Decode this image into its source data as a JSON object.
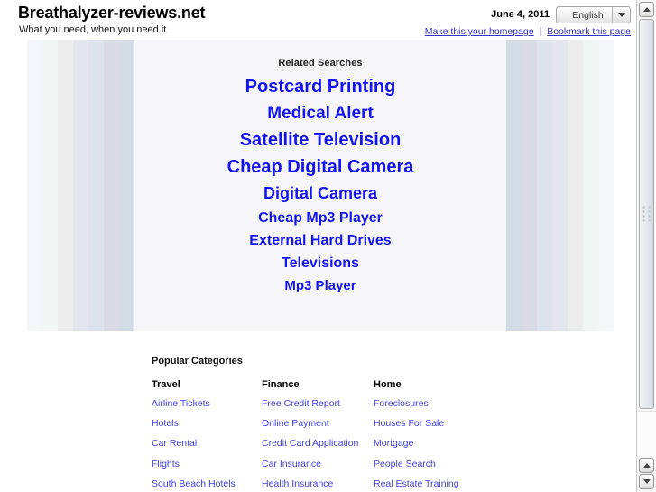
{
  "site": {
    "title": "Breathalyzer-reviews.net",
    "tagline": "What you need, when you need it"
  },
  "header": {
    "date": "June 4, 2011",
    "language_selected": "English",
    "language_options": [
      "English"
    ],
    "dropdown_icon": "chevron-down-icon",
    "links": [
      {
        "label": "Make this your homepage"
      },
      {
        "label": "Bookmark this page"
      }
    ],
    "link_separator": "|"
  },
  "related": {
    "title": "Related Searches",
    "background_color": "#f6f6f8",
    "link_color": "#1414ef",
    "stripe_colors": [
      "#f5f6fa",
      "#eff6f4",
      "#ededed",
      "#e4e5ee",
      "#dde3ec",
      "#d9dae4",
      "#d3dce6"
    ],
    "items": [
      {
        "label": "Postcard Printing",
        "size": 20
      },
      {
        "label": "Medical Alert",
        "size": 19
      },
      {
        "label": "Satellite Television",
        "size": 20
      },
      {
        "label": "Cheap Digital Camera",
        "size": 20
      },
      {
        "label": "Digital Camera",
        "size": 18
      },
      {
        "label": "Cheap Mp3 Player",
        "size": 16
      },
      {
        "label": "External Hard Drives",
        "size": 16
      },
      {
        "label": "Televisions",
        "size": 16
      },
      {
        "label": "Mp3 Player",
        "size": 15
      }
    ]
  },
  "popular": {
    "title": "Popular Categories",
    "link_color": "#4040e0",
    "columns": [
      {
        "heading": "Travel",
        "links": [
          "Airline Tickets",
          "Hotels",
          "Car Rental",
          "Flights",
          "South Beach Hotels"
        ]
      },
      {
        "heading": "Finance",
        "links": [
          "Free Credit Report",
          "Online Payment",
          "Credit Card Application",
          "Car Insurance",
          "Health Insurance"
        ]
      },
      {
        "heading": "Home",
        "links": [
          "Foreclosures",
          "Houses For Sale",
          "Mortgage",
          "People Search",
          "Real Estate Training"
        ]
      }
    ]
  },
  "scrollbar": {
    "up_icon_top": "triangle-up-icon",
    "up_icon_bottom": "triangle-up-icon",
    "down_icon_bottom": "triangle-down-icon",
    "grip_icon": "grip-dots-icon"
  }
}
